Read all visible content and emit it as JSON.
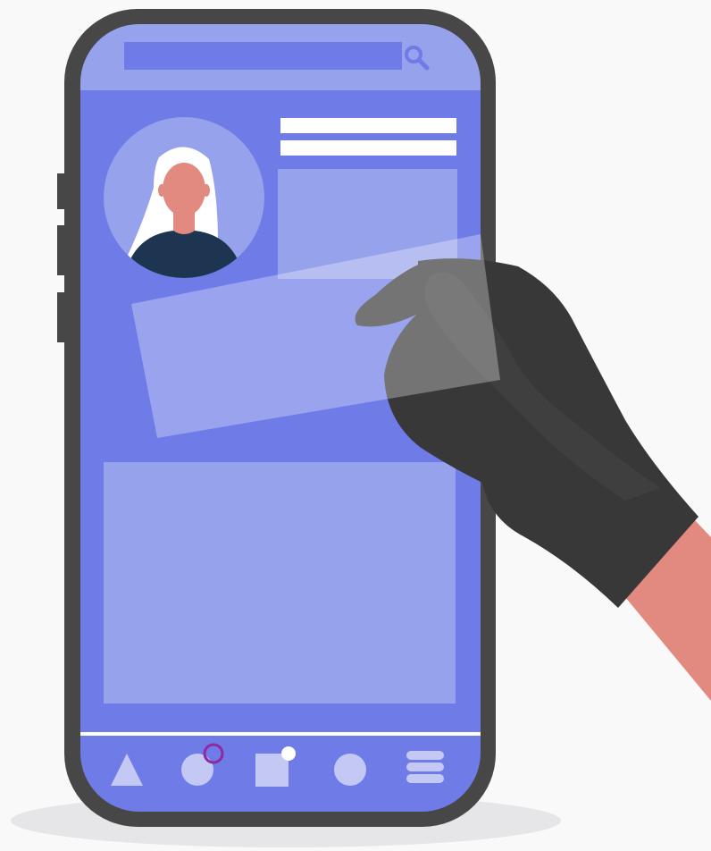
{
  "illustration": {
    "subject": "gloved-hand-stealing-id-card-from-phone-profile",
    "colors": {
      "background": "#F9F9F9",
      "shadow": "#E6E6E8",
      "phone_frame": "#474747",
      "screen_primary": "#6F7BE6",
      "screen_light": "#97A2EC",
      "screen_lighter": "#C3C8F4",
      "white": "#FFFFFF",
      "skin": "#E28A80",
      "shirt": "#1E3551",
      "glove": "#383838",
      "notification_ring": "#8E2AA0"
    }
  },
  "phone": {
    "search_bar": {
      "placeholder": "",
      "icon": "search-icon"
    },
    "profile": {
      "avatar_icon": "woman-avatar",
      "text_lines": 2
    },
    "bottom_nav": {
      "items": [
        {
          "icon": "triangle-icon"
        },
        {
          "icon": "circle-icon",
          "notification": "ring"
        },
        {
          "icon": "square-icon",
          "notification": "dot"
        },
        {
          "icon": "circle-icon"
        },
        {
          "icon": "menu-icon"
        }
      ]
    }
  }
}
